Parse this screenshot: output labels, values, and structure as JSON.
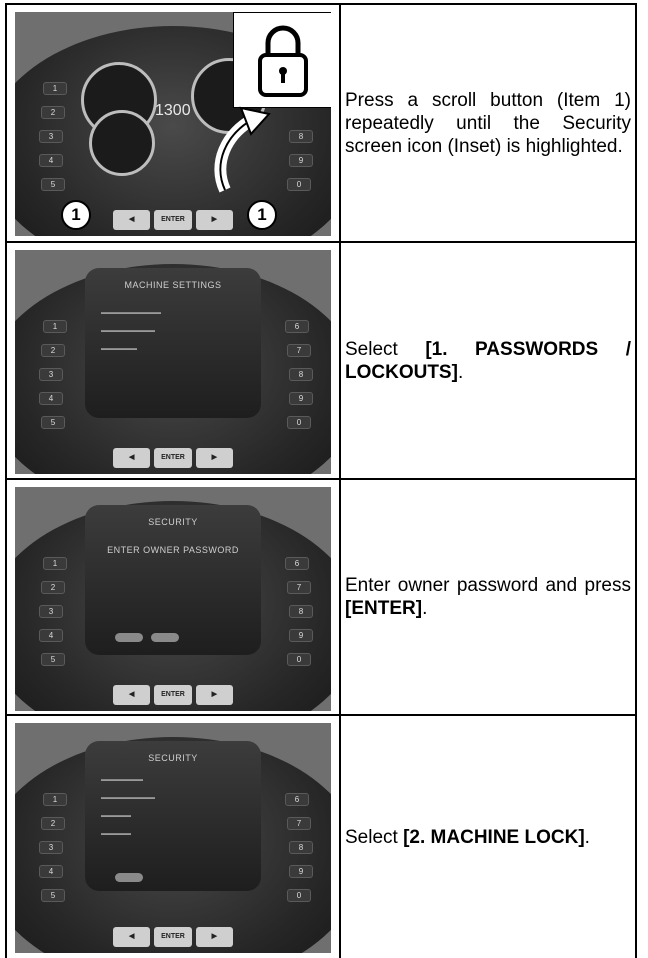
{
  "rows": [
    {
      "image": {
        "gauge_readout": "1300",
        "callout_label": "1",
        "enter_label": "ENTER",
        "icons": [
          "padlock-icon",
          "curved-arrow-icon"
        ]
      },
      "text": "Press a scroll button (Item 1) repeatedly until the Security screen icon (Inset) is highlighted."
    },
    {
      "image": {
        "screen_title": "MACHINE SETTINGS",
        "enter_label": "ENTER"
      },
      "text_before": "Select ",
      "text_bold": "[1. PASSWORDS / LOCKOUTS]",
      "text_after": "."
    },
    {
      "image": {
        "screen_title": "SECURITY",
        "screen_prompt": "ENTER OWNER PASSWORD",
        "enter_label": "ENTER"
      },
      "text_before": "Enter owner password and press ",
      "text_bold": "[ENTER]",
      "text_after": "."
    },
    {
      "image": {
        "screen_title": "SECURITY",
        "enter_label": "ENTER"
      },
      "text_before": "Select ",
      "text_bold": "[2. MACHINE LOCK]",
      "text_after": "."
    }
  ],
  "side_keys_left": [
    "1",
    "2",
    "3",
    "4",
    "5"
  ],
  "side_keys_right": [
    "6",
    "7",
    "8",
    "9",
    "0"
  ]
}
